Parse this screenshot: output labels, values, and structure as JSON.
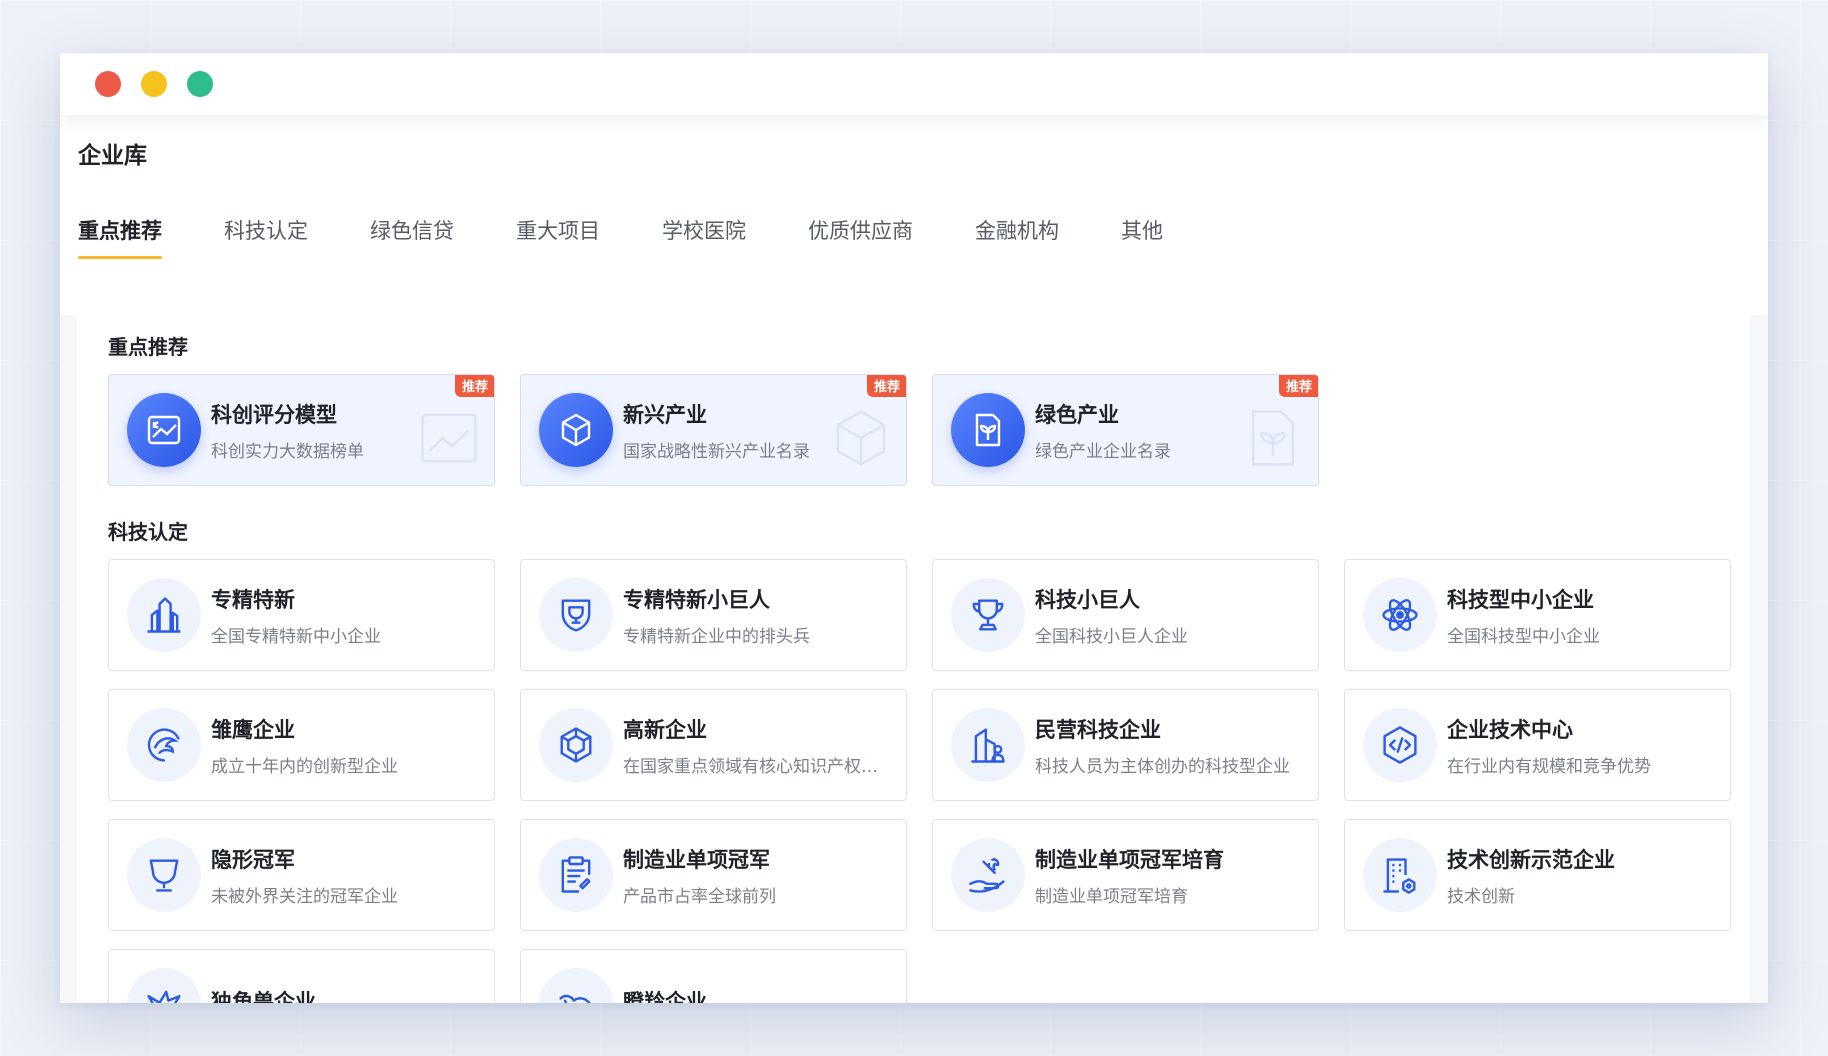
{
  "window": {
    "dots": [
      "#ee5a48",
      "#f6c21c",
      "#2ebd8e"
    ]
  },
  "header": {
    "title": "企业库",
    "tabs": [
      "重点推荐",
      "科技认定",
      "绿色信贷",
      "重大项目",
      "学校医院",
      "优质供应商",
      "金融机构",
      "其他"
    ]
  },
  "sections": [
    {
      "title": "重点推荐",
      "cards": [
        {
          "title": "科创评分模型",
          "desc": "科创实力大数据榜单",
          "badge": "推荐",
          "icon": "chart-image-icon"
        },
        {
          "title": "新兴产业",
          "desc": "国家战略性新兴产业名录",
          "badge": "推荐",
          "icon": "cube-icon"
        },
        {
          "title": "绿色产业",
          "desc": "绿色产业企业名录",
          "badge": "推荐",
          "icon": "leaf-doc-icon"
        }
      ]
    },
    {
      "title": "科技认定",
      "cards": [
        {
          "title": "专精特新",
          "desc": "全国专精特新中小企业",
          "icon": "buildings-icon"
        },
        {
          "title": "专精特新小巨人",
          "desc": "专精特新企业中的排头兵",
          "icon": "trophy-shield-icon"
        },
        {
          "title": "科技小巨人",
          "desc": "全国科技小巨人企业",
          "icon": "trophy-icon"
        },
        {
          "title": "科技型中小企业",
          "desc": "全国科技型中小企业",
          "icon": "atom-icon"
        },
        {
          "title": "雏鹰企业",
          "desc": "成立十年内的创新型企业",
          "icon": "eagle-icon"
        },
        {
          "title": "高新企业",
          "desc": "在国家重点领域有核心知识产权的企业",
          "icon": "hex-cube-icon"
        },
        {
          "title": "民营科技企业",
          "desc": "科技人员为主体创办的科技型企业",
          "icon": "person-building-icon"
        },
        {
          "title": "企业技术中心",
          "desc": "在行业内有规模和竞争优势",
          "icon": "code-hex-icon"
        },
        {
          "title": "隐形冠军",
          "desc": "未被外界关注的冠军企业",
          "icon": "cup-icon"
        },
        {
          "title": "制造业单项冠军",
          "desc": "产品市占率全球前列",
          "icon": "clipboard-wrench-icon"
        },
        {
          "title": "制造业单项冠军培育",
          "desc": "制造业单项冠军培育",
          "icon": "hand-wrench-icon"
        },
        {
          "title": "技术创新示范企业",
          "desc": "技术创新",
          "icon": "building-gear-icon"
        },
        {
          "title": "独角兽企业",
          "desc": "",
          "icon": "unicorn-icon"
        },
        {
          "title": "瞪羚企业",
          "desc": "",
          "icon": "gazelle-icon"
        }
      ]
    }
  ]
}
